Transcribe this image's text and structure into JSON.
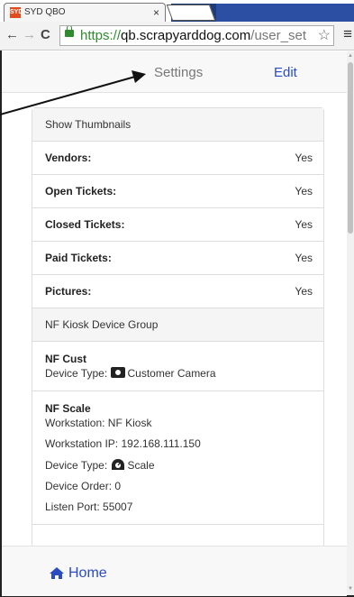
{
  "browser": {
    "tab_title": "SYD QBO",
    "tab_close": "×",
    "favicon_text": "SYD",
    "url_scheme": "https://",
    "url_host": "qb.scrapyarddog.com",
    "url_path": "/user_set",
    "back": "←",
    "forward": "→",
    "reload": "C",
    "star": "☆",
    "menu": "≡"
  },
  "header": {
    "settings_label": "Settings",
    "edit_label": "Edit"
  },
  "thumbnails": {
    "heading": "Show Thumbnails",
    "rows": [
      {
        "label": "Vendors:",
        "value": "Yes"
      },
      {
        "label": "Open Tickets:",
        "value": "Yes"
      },
      {
        "label": "Closed Tickets:",
        "value": "Yes"
      },
      {
        "label": "Paid Tickets:",
        "value": "Yes"
      },
      {
        "label": "Pictures:",
        "value": "Yes"
      }
    ]
  },
  "device_group": {
    "heading": "NF Kiosk Device Group",
    "devices": [
      {
        "name": "NF Cust",
        "device_type_label": "Device Type:",
        "device_type": "Customer Camera",
        "icon": "camera-icon"
      },
      {
        "name": "NF Scale",
        "workstation": "Workstation: NF Kiosk",
        "workstation_ip": "Workstation IP: 192.168.111.150",
        "device_type_label": "Device Type:",
        "device_type": "Scale",
        "icon": "scale-icon",
        "device_order": "Device Order: 0",
        "listen_port": "Listen Port: 55007"
      }
    ]
  },
  "footer": {
    "home_label": "Home"
  },
  "colors": {
    "link": "#2b4cc0",
    "secure": "#2e8b2e"
  }
}
